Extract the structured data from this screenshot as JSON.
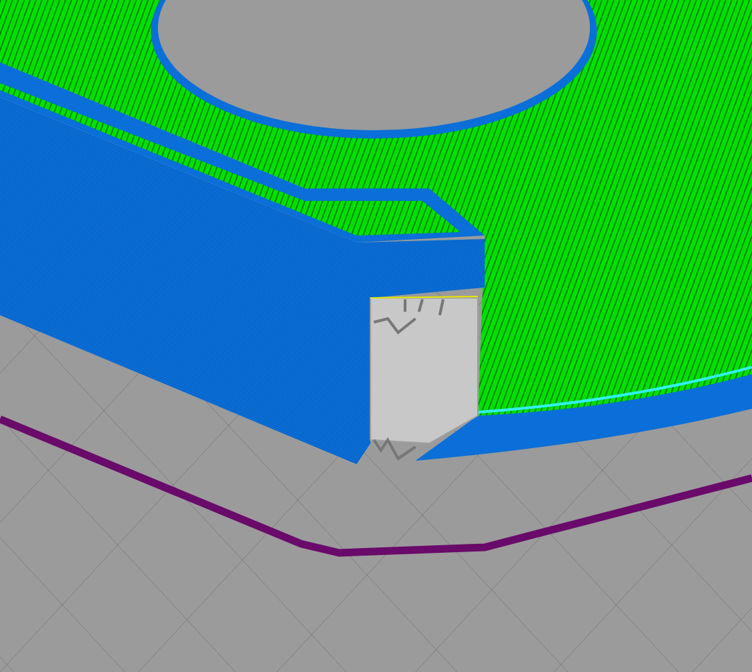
{
  "viewport": {
    "kind": "toolpath-preview"
  }
}
